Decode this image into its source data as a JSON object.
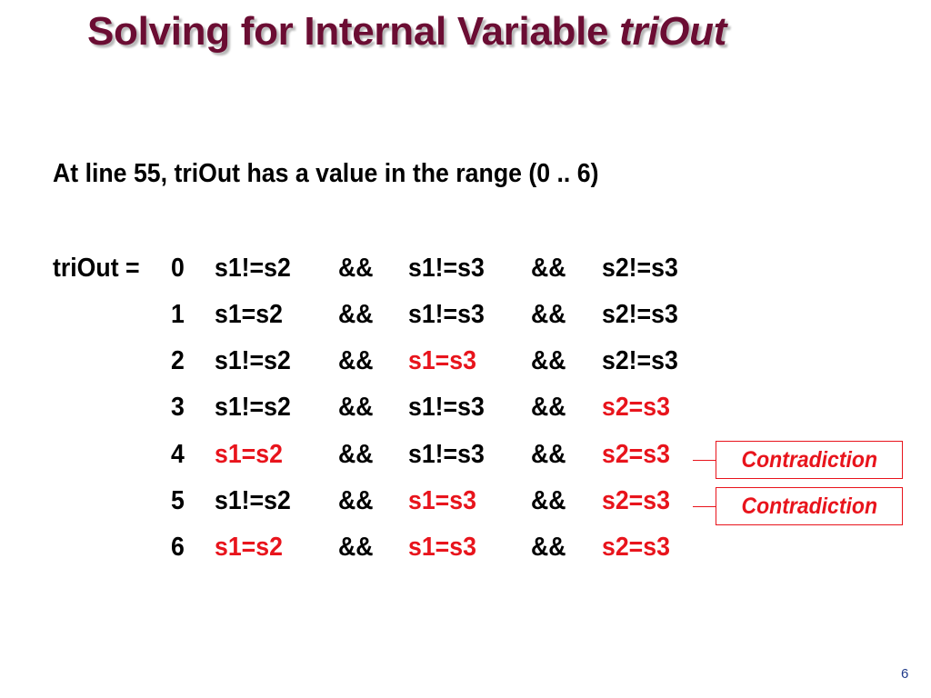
{
  "slide": {
    "title_prefix": "Solving for Internal Variable ",
    "title_emphasis": "triOut",
    "subtitle": "At line 55, triOut has a value in the range (0 .. 6)",
    "lhs_label": "triOut =",
    "operator": "&&",
    "colors": {
      "title": "#6b0d33",
      "highlight": "#e8141c",
      "text": "#000000",
      "page_number": "#1f3a8a"
    },
    "rows": [
      {
        "value": "0",
        "conditions": [
          {
            "text": "s1!=s2",
            "highlight": false
          },
          {
            "text": "s1!=s3",
            "highlight": false
          },
          {
            "text": "s2!=s3",
            "highlight": false
          }
        ],
        "callout": null
      },
      {
        "value": "1",
        "conditions": [
          {
            "text": "s1=s2",
            "highlight": false
          },
          {
            "text": "s1!=s3",
            "highlight": false
          },
          {
            "text": "s2!=s3",
            "highlight": false
          }
        ],
        "callout": null
      },
      {
        "value": "2",
        "conditions": [
          {
            "text": "s1!=s2",
            "highlight": false
          },
          {
            "text": "s1=s3",
            "highlight": true
          },
          {
            "text": "s2!=s3",
            "highlight": false
          }
        ],
        "callout": null
      },
      {
        "value": "3",
        "conditions": [
          {
            "text": "s1!=s2",
            "highlight": false
          },
          {
            "text": "s1!=s3",
            "highlight": false
          },
          {
            "text": "s2=s3",
            "highlight": true
          }
        ],
        "callout": null
      },
      {
        "value": "4",
        "conditions": [
          {
            "text": "s1=s2",
            "highlight": true
          },
          {
            "text": "s1!=s3",
            "highlight": false
          },
          {
            "text": "s2=s3",
            "highlight": true
          }
        ],
        "callout": "Contradiction"
      },
      {
        "value": "5",
        "conditions": [
          {
            "text": "s1!=s2",
            "highlight": false
          },
          {
            "text": "s1=s3",
            "highlight": true
          },
          {
            "text": "s2=s3",
            "highlight": true
          }
        ],
        "callout": "Contradiction"
      },
      {
        "value": "6",
        "conditions": [
          {
            "text": "s1=s2",
            "highlight": true
          },
          {
            "text": "s1=s3",
            "highlight": true
          },
          {
            "text": "s2=s3",
            "highlight": true
          }
        ],
        "callout": null
      }
    ],
    "page_number": "6"
  }
}
